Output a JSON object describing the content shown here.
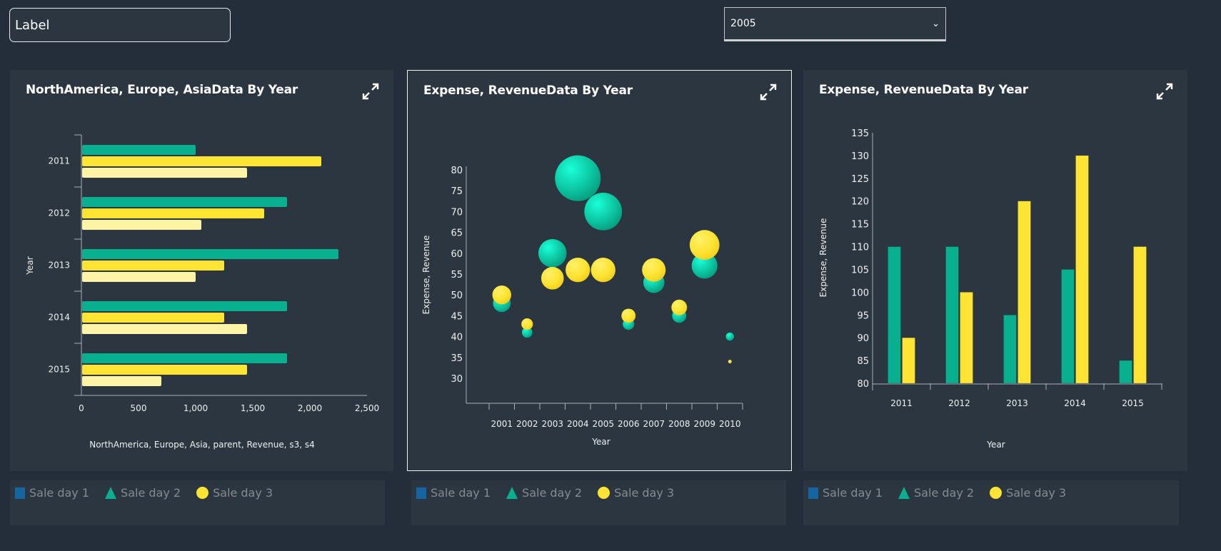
{
  "header": {
    "label_input_value": "Label",
    "year_select_value": "2005"
  },
  "colors": {
    "teal": "#09b08f",
    "yellow": "#ffe433",
    "light_yellow": "#fff3a6",
    "legend_square": "#1565a0"
  },
  "legend": {
    "items": [
      {
        "label": "Sale day 1",
        "shape": "square"
      },
      {
        "label": "Sale day 2",
        "shape": "triangle"
      },
      {
        "label": "Sale day 3",
        "shape": "circle"
      }
    ]
  },
  "chart_data": [
    {
      "type": "bar",
      "orientation": "horizontal",
      "title": "NorthAmerica, Europe, AsiaData By Year",
      "xlabel": "NorthAmerica, Europe, Asia, parent, Revenue, s3, s4",
      "ylabel": "Year",
      "categories": [
        "2011",
        "2012",
        "2013",
        "2014",
        "2015"
      ],
      "xlim": [
        0,
        2500
      ],
      "xticks": [
        "0",
        "500",
        "1,000",
        "1,500",
        "2,000",
        "2,500"
      ],
      "series": [
        {
          "values": [
            1000,
            1800,
            2250,
            1800,
            1800
          ],
          "color": "#09b08f"
        },
        {
          "values": [
            2100,
            1600,
            1250,
            1250,
            1450
          ],
          "color": "#ffe433"
        },
        {
          "values": [
            1450,
            1050,
            1000,
            1450,
            700
          ],
          "color": "#fff3a6"
        }
      ]
    },
    {
      "type": "bubble",
      "title": "Expense, RevenueData By Year",
      "xlabel": "Year",
      "ylabel": "Expense, Revenue",
      "categories": [
        "2001",
        "2002",
        "2003",
        "2004",
        "2005",
        "2006",
        "2007",
        "2008",
        "2009",
        "2010"
      ],
      "ylim": [
        25,
        80
      ],
      "yticks": [
        "30",
        "35",
        "40",
        "45",
        "50",
        "55",
        "60",
        "65",
        "70",
        "75",
        "80"
      ],
      "series": [
        {
          "color": "#09b08f",
          "values": [
            48,
            41,
            60,
            78,
            70,
            43,
            53,
            45,
            57,
            40
          ],
          "sizes": [
            14,
            5,
            36,
            94,
            64,
            6,
            20,
            9,
            30,
            3
          ]
        },
        {
          "color": "#ffe433",
          "values": [
            50,
            43,
            54,
            56,
            56,
            45,
            56,
            47,
            62,
            34
          ],
          "sizes": [
            16,
            6,
            23,
            27,
            27,
            9,
            25,
            11,
            40,
            0.4
          ]
        }
      ]
    },
    {
      "type": "bar",
      "orientation": "vertical",
      "title": "Expense, RevenueData By Year",
      "xlabel": "Year",
      "ylabel": "Expense, Revenue",
      "categories": [
        "2011",
        "2012",
        "2013",
        "2014",
        "2015"
      ],
      "ylim": [
        80,
        135
      ],
      "yticks": [
        "80",
        "85",
        "90",
        "95",
        "100",
        "105",
        "110",
        "115",
        "120",
        "125",
        "130",
        "135"
      ],
      "series": [
        {
          "values": [
            110,
            110,
            95,
            105,
            85
          ],
          "color": "#09b08f"
        },
        {
          "values": [
            90,
            100,
            120,
            130,
            110
          ],
          "color": "#ffe433"
        }
      ]
    }
  ]
}
